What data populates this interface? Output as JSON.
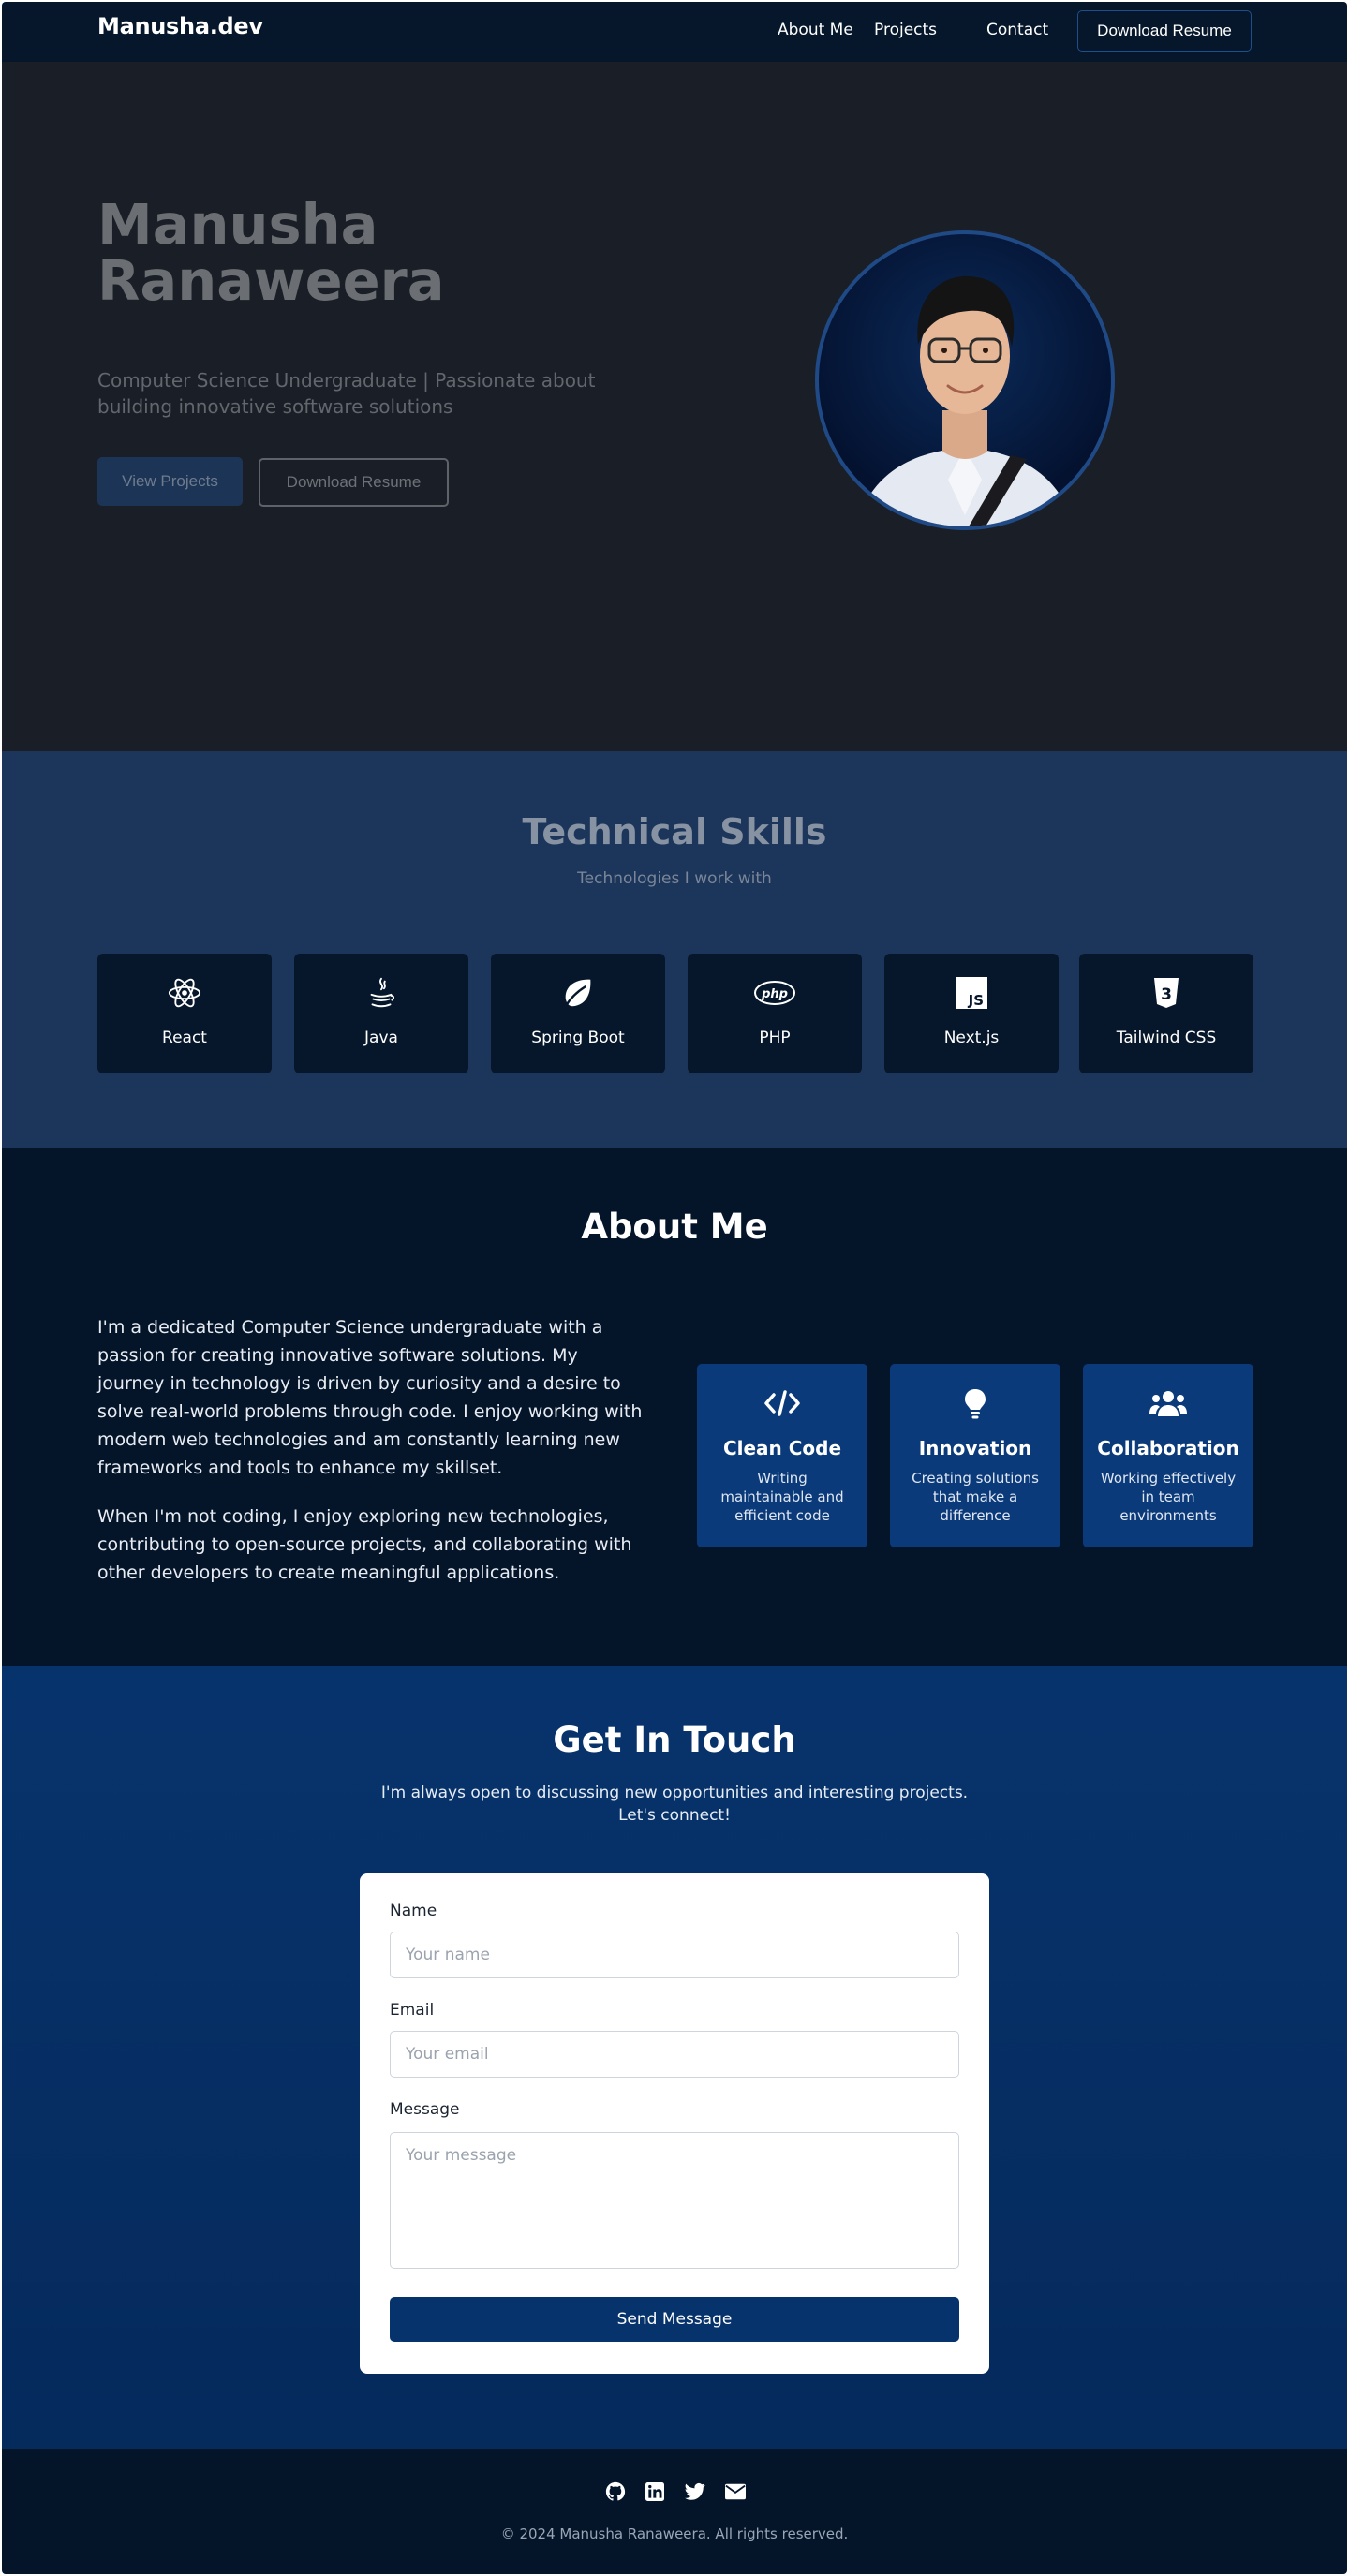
{
  "nav": {
    "brand": "Manusha.dev",
    "links": [
      "About Me",
      "Projects",
      "Contact"
    ],
    "cta": "Download Resume"
  },
  "hero": {
    "name_line1": "Manusha",
    "name_line2": "Ranaweera",
    "subtitle": "Computer Science Undergraduate | Passionate about building innovative software solutions",
    "primary_button": "View Projects",
    "secondary_button": "Download Resume"
  },
  "skills": {
    "title": "Technical Skills",
    "subtitle": "Technologies I work with",
    "items": [
      {
        "label": "React",
        "icon": "react-icon"
      },
      {
        "label": "Java",
        "icon": "java-icon"
      },
      {
        "label": "Spring Boot",
        "icon": "spring-leaf-icon"
      },
      {
        "label": "PHP",
        "icon": "php-icon"
      },
      {
        "label": "Next.js",
        "icon": "js-icon"
      },
      {
        "label": "Tailwind CSS",
        "icon": "css3-icon"
      }
    ]
  },
  "about": {
    "title": "About Me",
    "paragraph1": "I'm a dedicated Computer Science undergraduate with a passion for creating innovative software solutions. My journey in technology is driven by curiosity and a desire to solve real-world problems through code. I enjoy working with modern web technologies and am constantly learning new frameworks and tools to enhance my skillset.",
    "paragraph2": "When I'm not coding, I enjoy exploring new technologies, contributing to open-source projects, and collaborating with other developers to create meaningful applications.",
    "features": [
      {
        "title": "Clean Code",
        "desc": "Writing maintainable and efficient code",
        "icon": "code-icon"
      },
      {
        "title": "Innovation",
        "desc": "Creating solutions that make a difference",
        "icon": "lightbulb-icon"
      },
      {
        "title": "Collaboration",
        "desc": "Working effectively in team environments",
        "icon": "users-icon"
      }
    ]
  },
  "contact": {
    "title": "Get In Touch",
    "subtitle": "I'm always open to discussing new opportunities and interesting projects. Let's connect!",
    "name_label": "Name",
    "name_placeholder": "Your name",
    "email_label": "Email",
    "email_placeholder": "Your email",
    "message_label": "Message",
    "message_placeholder": "Your message",
    "submit": "Send Message"
  },
  "footer": {
    "social": [
      "github-icon",
      "linkedin-icon",
      "twitter-icon",
      "envelope-icon"
    ],
    "copyright": "© 2024 Manusha Ranaweera. All rights reserved."
  },
  "colors": {
    "nav_bg": "#06172b",
    "hero_bg": "#1a1f27",
    "skills_bg": "#1c355a",
    "about_bg": "#04152a",
    "contact_bg": "#07336c",
    "feature_card": "#0a3a7a"
  }
}
